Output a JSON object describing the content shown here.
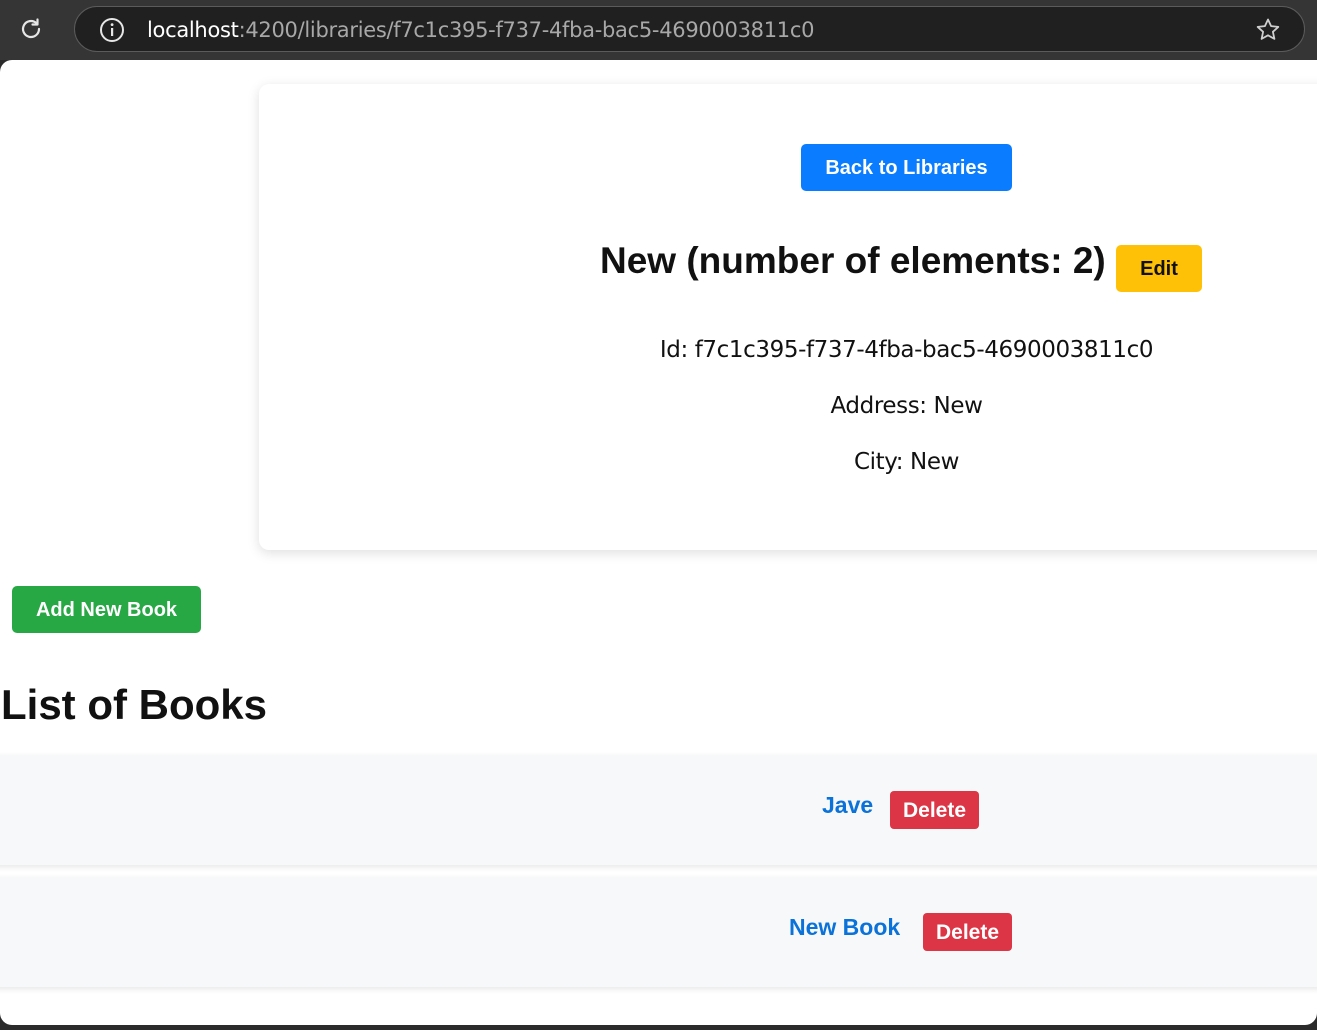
{
  "browser": {
    "url_host": "localhost",
    "url_rest": ":4200/libraries/f7c1c395-f737-4fba-bac5-4690003811c0"
  },
  "icons": {
    "reload": "reload-icon",
    "info": "info-icon",
    "bookmark": "star-icon"
  },
  "library": {
    "back_label": "Back to Libraries",
    "title": "New (number of elements: 2)",
    "edit_label": "Edit",
    "id_line": "Id: f7c1c395-f737-4fba-bac5-4690003811c0",
    "address_line": "Address: New",
    "city_line": "City: New"
  },
  "books": {
    "add_label": "Add New Book",
    "heading": "List of Books",
    "items": [
      {
        "title": "Jave",
        "delete_label": "Delete"
      },
      {
        "title": "New Book",
        "delete_label": "Delete"
      }
    ]
  },
  "colors": {
    "primary": "#0a7cff",
    "warning": "#ffc107",
    "success": "#28a745",
    "danger": "#dc3545",
    "link": "#0a72d8"
  }
}
